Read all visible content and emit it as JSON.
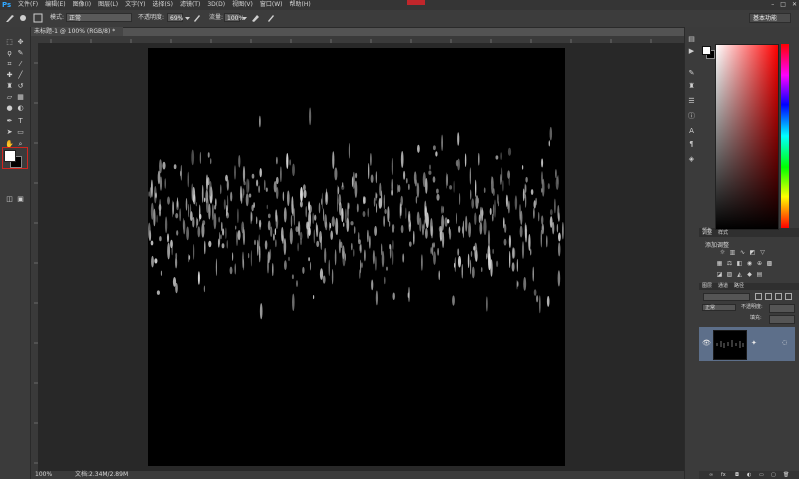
{
  "app": {
    "logo": "Ps"
  },
  "menubar": {
    "items": [
      "文件(F)",
      "编辑(E)",
      "图像(I)",
      "图层(L)",
      "文字(Y)",
      "选择(S)",
      "滤镜(T)",
      "3D(D)",
      "视图(V)",
      "窗口(W)",
      "帮助(H)"
    ],
    "window_controls": [
      "–",
      "□",
      "✕"
    ]
  },
  "options_bar": {
    "mode_label": "模式:",
    "mode_value": "正常",
    "opacity_label": "不透明度:",
    "opacity_value": "69%",
    "flow_label": "流量:",
    "flow_value": "100%",
    "workspace": "基本功能"
  },
  "document": {
    "tab_title": "未标题-1 @ 100% (RGB/8) *",
    "zoom": "100%",
    "doc_info": "文档:2.34M/2.89M"
  },
  "colors": {
    "foreground": "#ffffff",
    "background": "#000000",
    "selection_accent": "#d1261f",
    "layer_selected": "#5d6f8a"
  },
  "panels": {
    "color_tabs": [
      "颜色",
      "色板"
    ],
    "adjust_tabs": [
      "调整",
      "样式"
    ],
    "adjust_title": "添加调整",
    "layers_tabs": [
      "图层",
      "通道",
      "路径"
    ],
    "layers_blend": "正常",
    "layers_opacity_label": "不透明度:",
    "layers_fill_label": "填充:"
  }
}
